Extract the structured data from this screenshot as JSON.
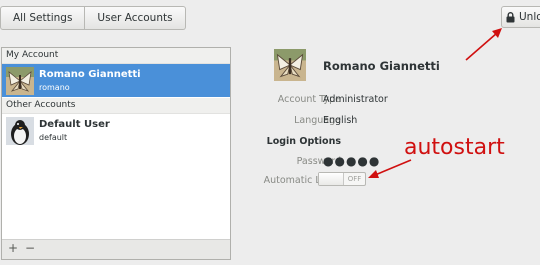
{
  "toolbar": {
    "all_settings_label": "All Settings",
    "user_accounts_label": "User Accounts",
    "unlock_label": "Unlock"
  },
  "sidebar": {
    "my_account_header": "My Account",
    "other_accounts_header": "Other Accounts",
    "users": [
      {
        "name": "Romano Giannetti",
        "username": "romano",
        "selected": true,
        "avatar_icon": "butterfly-photo-icon"
      },
      {
        "name": "Default User",
        "username": "default",
        "selected": false,
        "avatar_icon": "penguin-icon"
      }
    ],
    "add_label": "+",
    "remove_label": "−"
  },
  "details": {
    "full_name": "Romano Giannetti",
    "account_type_label": "Account Type",
    "account_type_value": "Administrator",
    "language_label": "Language",
    "language_value": "English",
    "login_options_label": "Login Options",
    "password_label": "Password",
    "password_value": "●●●●●",
    "automatic_login_label": "Automatic Login",
    "automatic_login_state": "OFF"
  },
  "annotations": {
    "autostart_text": "autostart",
    "color": "#d01010"
  },
  "colors": {
    "selection": "#4a90d9",
    "background": "#ededed"
  }
}
